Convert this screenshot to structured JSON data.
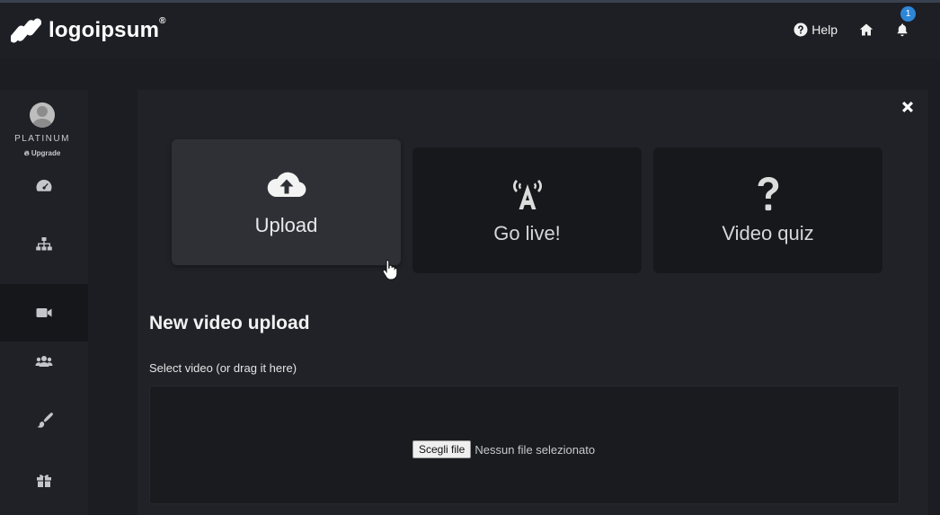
{
  "header": {
    "logo_text": "logoipsum",
    "logo_mark": "®",
    "help_label": "Help",
    "notification_count": "1"
  },
  "sidebar": {
    "plan": "PLATINUM",
    "upgrade_label": "Upgrade",
    "items": [
      {
        "icon": "dashboard-icon"
      },
      {
        "icon": "sitemap-icon"
      },
      {
        "icon": "video-camera-icon",
        "active": true
      },
      {
        "icon": "users-icon"
      },
      {
        "icon": "brush-icon"
      },
      {
        "icon": "gift-icon"
      }
    ]
  },
  "options": [
    {
      "label": "Upload",
      "icon": "cloud-upload-icon",
      "selected": true
    },
    {
      "label": "Go live!",
      "icon": "broadcast-icon",
      "selected": false
    },
    {
      "label": "Video quiz",
      "icon": "question-icon",
      "selected": false
    }
  ],
  "upload": {
    "title": "New video upload",
    "field_label": "Select video (or drag it here)",
    "choose_file_label": "Scegli file",
    "file_status": "Nessun file selezionato"
  },
  "colors": {
    "background": "#1b1d22",
    "panel": "#202227",
    "card_selected": "#2e3036",
    "card": "#17181c",
    "badge": "#2e86d6"
  }
}
